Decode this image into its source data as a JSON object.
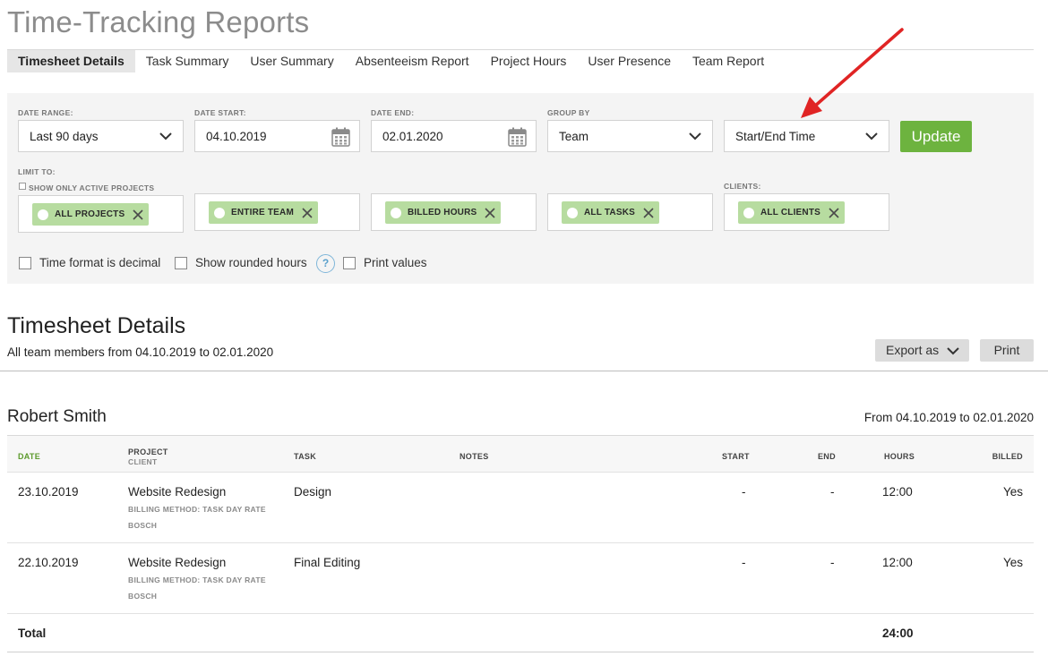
{
  "app": {
    "title": "Time-Tracking Reports"
  },
  "tabs": [
    {
      "label": "Timesheet Details",
      "active": true
    },
    {
      "label": "Task Summary"
    },
    {
      "label": "User Summary"
    },
    {
      "label": "Absenteeism Report"
    },
    {
      "label": "Project Hours"
    },
    {
      "label": "User Presence"
    },
    {
      "label": "Team Report"
    }
  ],
  "filters": {
    "date_range": {
      "label": "DATE RANGE:",
      "value": "Last 90 days"
    },
    "date_start": {
      "label": "DATE START:",
      "value": "04.10.2019"
    },
    "date_end": {
      "label": "DATE END:",
      "value": "02.01.2020"
    },
    "group_by": {
      "label": "GROUP BY",
      "value": "Team"
    },
    "time_mode": {
      "value": "Start/End Time"
    },
    "update_label": "Update",
    "limit_label": "LIMIT TO:",
    "active_projects_label": "SHOW ONLY ACTIVE PROJECTS",
    "clients_label": "CLIENTS:",
    "tags": {
      "projects": "ALL PROJECTS",
      "team": "ENTIRE TEAM",
      "hours": "BILLED HOURS",
      "tasks": "ALL TASKS",
      "clients": "ALL CLIENTS"
    },
    "options": {
      "decimal": "Time format is decimal",
      "rounded": "Show rounded hours",
      "help": "?",
      "print_values": "Print values"
    }
  },
  "report": {
    "title": "Timesheet Details",
    "subtitle": "All team members from 04.10.2019 to 02.01.2020",
    "export_label": "Export as",
    "print_label": "Print"
  },
  "person": {
    "name": "Robert Smith",
    "range": "From 04.10.2019 to 02.01.2020"
  },
  "table": {
    "headers": {
      "date": "DATE",
      "project": "PROJECT",
      "client": "CLIENT",
      "task": "TASK",
      "notes": "NOTES",
      "start": "START",
      "end": "END",
      "hours": "HOURS",
      "billed": "BILLED"
    },
    "rows": [
      {
        "date": "23.10.2019",
        "project": "Website Redesign",
        "billing": "BILLING METHOD: TASK DAY RATE",
        "client": "BOSCH",
        "task": "Design",
        "start": "-",
        "end": "-",
        "hours": "12:00",
        "billed": "Yes"
      },
      {
        "date": "22.10.2019",
        "project": "Website Redesign",
        "billing": "BILLING METHOD: TASK DAY RATE",
        "client": "BOSCH",
        "task": "Final Editing",
        "start": "-",
        "end": "-",
        "hours": "12:00",
        "billed": "Yes"
      }
    ],
    "total_label": "Total",
    "total_hours": "24:00"
  },
  "colors": {
    "accent_green": "#6db33f",
    "tag_green": "#b7dca0",
    "annotation_red": "#e02424"
  }
}
